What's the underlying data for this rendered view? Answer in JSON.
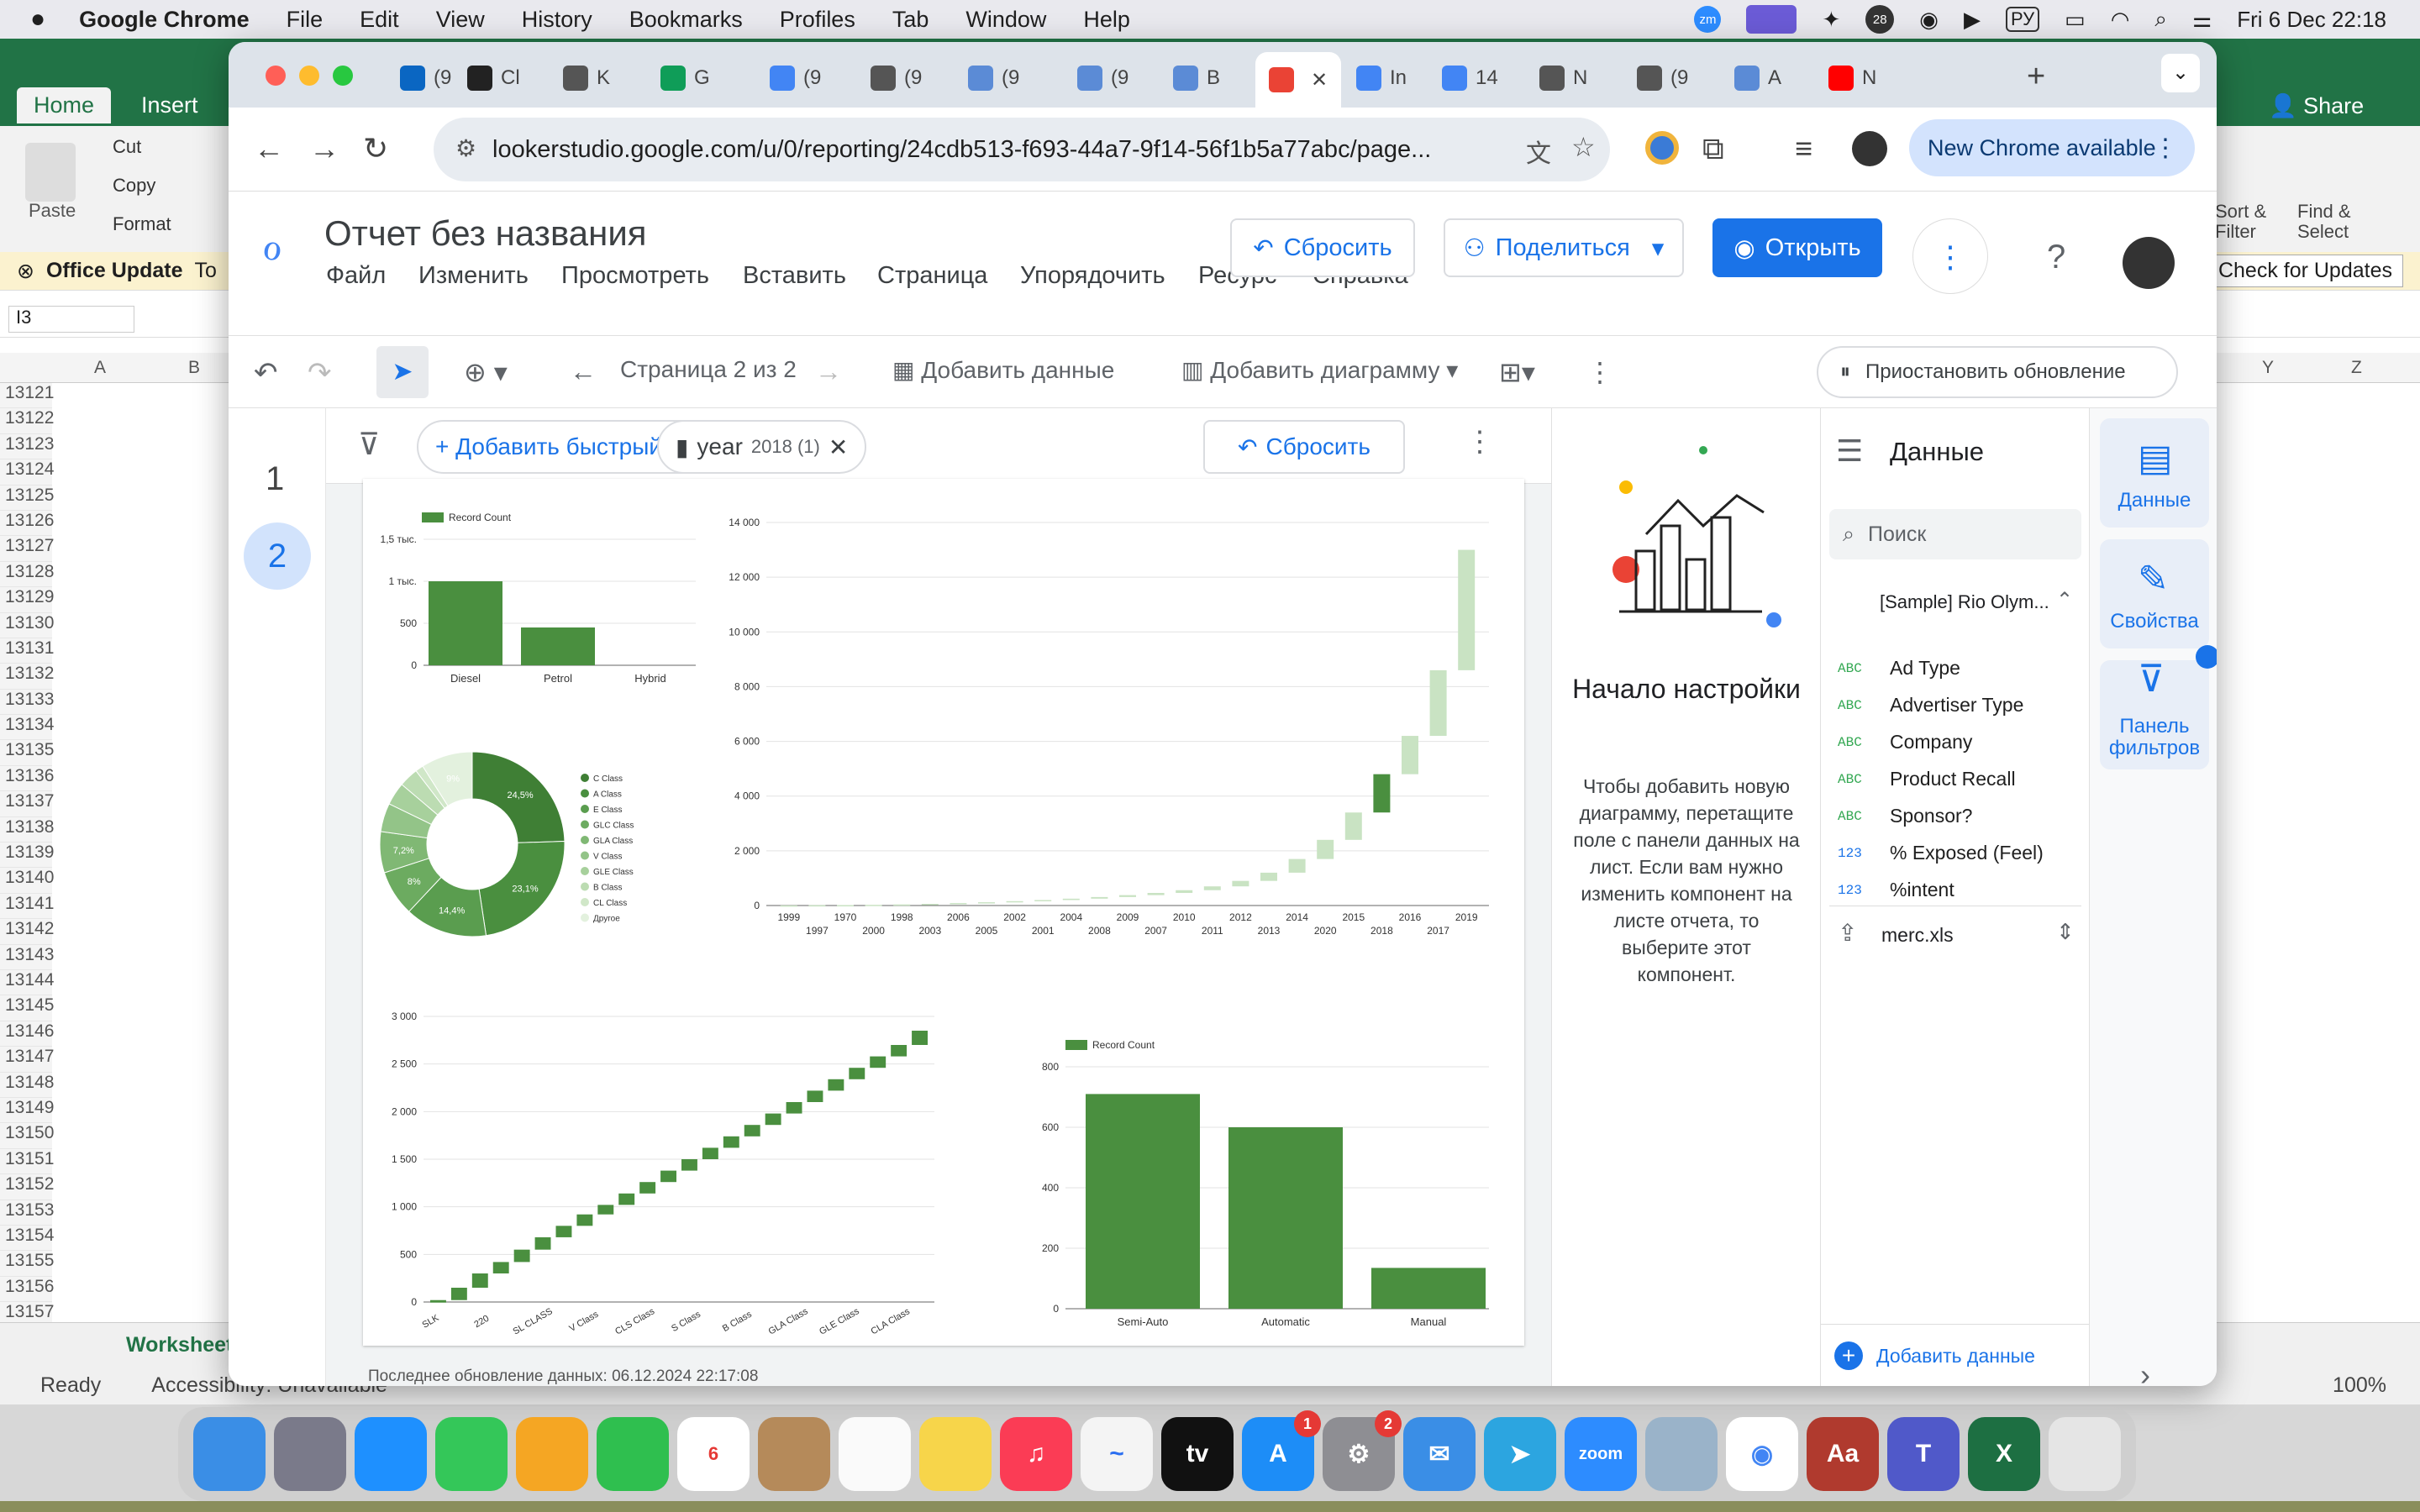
{
  "menubar": {
    "app": "Google Chrome",
    "items": [
      "File",
      "Edit",
      "View",
      "History",
      "Bookmarks",
      "Profiles",
      "Tab",
      "Window",
      "Help"
    ],
    "lang": "РУ",
    "datetime": "Fri 6 Dec  22:18"
  },
  "excel": {
    "tabs": [
      "Home",
      "Insert"
    ],
    "clipboard": [
      "Cut",
      "Copy",
      "Format"
    ],
    "paste": "Paste",
    "update_title": "Office Update",
    "update_text": "To",
    "check_updates": "Check for Updates",
    "share": "Share",
    "sort_filter": "Sort & Filter",
    "find_select": "Find & Select",
    "cell_ref": "I3",
    "cols": [
      "A",
      "B",
      "Y",
      "Z"
    ],
    "rows": [
      "13121",
      "13122",
      "13123",
      "13124",
      "13125",
      "13126",
      "13127",
      "13128",
      "13129",
      "13130",
      "13131",
      "13132",
      "13133",
      "13134",
      "13135",
      "13136",
      "13137",
      "13138",
      "13139",
      "13140",
      "13141",
      "13142",
      "13143",
      "13144",
      "13145",
      "13146",
      "13147",
      "13148",
      "13149",
      "13150",
      "13151",
      "13152",
      "13153",
      "13154",
      "13155",
      "13156",
      "13157"
    ],
    "sheet_tab": "Worksheet",
    "status": "Ready",
    "accessibility": "Accessibility: Unavailable",
    "zoom": "100%"
  },
  "chrome": {
    "tab_labels": [
      "(9",
      "Cl",
      "K",
      "G",
      "(9",
      "(9",
      "(9",
      "(9",
      "B",
      "",
      "In",
      "14",
      "N",
      "(9",
      "A",
      "N"
    ],
    "url": "lookerstudio.google.com/u/0/reporting/24cdb513-f693-44a7-9f14-56f1b5a77abc/page...",
    "new_chrome": "New Chrome available"
  },
  "looker": {
    "title": "Отчет без названия",
    "menu": [
      "Файл",
      "Изменить",
      "Просмотреть",
      "Вставить",
      "Страница",
      "Упорядочить",
      "Ресурс",
      "Справка"
    ],
    "reset": "Сбросить",
    "share": "Поделиться",
    "open": "Открыть",
    "page_label": "Страница 2 из 2",
    "add_data": "Добавить данные",
    "add_chart": "Добавить диаграмму",
    "pause": "Приостановить обновление",
    "pages": [
      "1",
      "2"
    ],
    "quick_filter": "+ Добавить быстрый фильтр",
    "filter_chip": "year",
    "filter_value": "2018 (1)",
    "filter_reset": "Сбросить",
    "last_update": "Последнее обновление данных: 06.12.2024 22:17:08"
  },
  "setup": {
    "title": "Начало настройки",
    "text": "Чтобы добавить новую диаграмму, перетащите поле с панели данных на лист. Если вам нужно изменить компонент на листе отчета, то выберите этот компонент."
  },
  "data_panel": {
    "title": "Данные",
    "search_placeholder": "Поиск",
    "source": "[Sample] Rio Olym...",
    "fields": [
      {
        "type": "ABC",
        "name": "Ad Type"
      },
      {
        "type": "ABC",
        "name": "Advertiser Type"
      },
      {
        "type": "ABC",
        "name": "Company"
      },
      {
        "type": "ABC",
        "name": "Product Recall"
      },
      {
        "type": "ABC",
        "name": "Sponsor?"
      },
      {
        "type": "123",
        "name": "% Exposed (Feel)"
      },
      {
        "type": "123",
        "name": "%intent"
      }
    ],
    "file": "merc.xls",
    "add_data": "Добавить данные"
  },
  "side_tabs": [
    "Данные",
    "Свойства",
    "Панель фильтров"
  ],
  "colors": {
    "accent": "#1a73e8",
    "chart_green": "#4a8f3f"
  },
  "chart_data": [
    {
      "type": "bar",
      "legend": "Record Count",
      "categories": [
        "Diesel",
        "Petrol",
        "Hybrid"
      ],
      "values": [
        1000,
        450,
        0
      ],
      "ylim": [
        0,
        1500
      ],
      "ticks": [
        "0",
        "500",
        "1 тыс.",
        "1,5 тыс."
      ]
    },
    {
      "type": "pie",
      "donut": true,
      "categories": [
        "C Class",
        "A Class",
        "E Class",
        "GLC Class",
        "GLA Class",
        "V Class",
        "GLE Class",
        "B Class",
        "CL Class",
        "Другое"
      ],
      "values": [
        24.5,
        23.1,
        14.4,
        8,
        7.2,
        5,
        4,
        3.4,
        1.4,
        9
      ],
      "labels": [
        "24,5%",
        "23,1%",
        "14,4%",
        "8%",
        "7,2%",
        "",
        "",
        "",
        "",
        "9%"
      ]
    },
    {
      "type": "waterfall",
      "categories": [
        "1999",
        "1997",
        "1970",
        "2000",
        "1998",
        "2003",
        "2006",
        "2005",
        "2002",
        "2001",
        "2004",
        "2008",
        "2009",
        "2007",
        "2010",
        "2011",
        "2012",
        "2013",
        "2014",
        "2020",
        "2015",
        "2018",
        "2016",
        "2017",
        "2019"
      ],
      "ylim": [
        0,
        14000
      ],
      "ticks": [
        "0",
        "2 000",
        "4 000",
        "6 000",
        "8 000",
        "10 000",
        "12 000",
        "14 000"
      ],
      "cumulative_end": [
        5,
        12,
        15,
        25,
        40,
        60,
        90,
        120,
        160,
        200,
        250,
        310,
        380,
        460,
        560,
        700,
        900,
        1200,
        1700,
        2400,
        3400,
        4800,
        6200,
        8600,
        13000
      ],
      "highlight": "2018"
    },
    {
      "type": "waterfall",
      "categories": [
        "SLK",
        "220",
        "SL CLASS",
        "V Class",
        "CLS Class",
        "S Class",
        "B Class",
        "GLA Class",
        "GLE Class",
        "CLA Class"
      ],
      "ylim": [
        0,
        3000
      ],
      "ticks": [
        "0",
        "500",
        "1 000",
        "1 500",
        "2 000",
        "2 500",
        "3 000"
      ],
      "cumulative_end": [
        20,
        150,
        300,
        420,
        550,
        680,
        800,
        920,
        1020,
        1140,
        1260,
        1380,
        1500,
        1620,
        1740,
        1860,
        1980,
        2100,
        2220,
        2340,
        2460,
        2580,
        2700,
        2850
      ]
    },
    {
      "type": "bar",
      "legend": "Record Count",
      "categories": [
        "Semi-Auto",
        "Automatic",
        "Manual"
      ],
      "values": [
        710,
        600,
        135
      ],
      "ylim": [
        0,
        800
      ],
      "ticks": [
        "0",
        "200",
        "400",
        "600",
        "800"
      ]
    }
  ]
}
